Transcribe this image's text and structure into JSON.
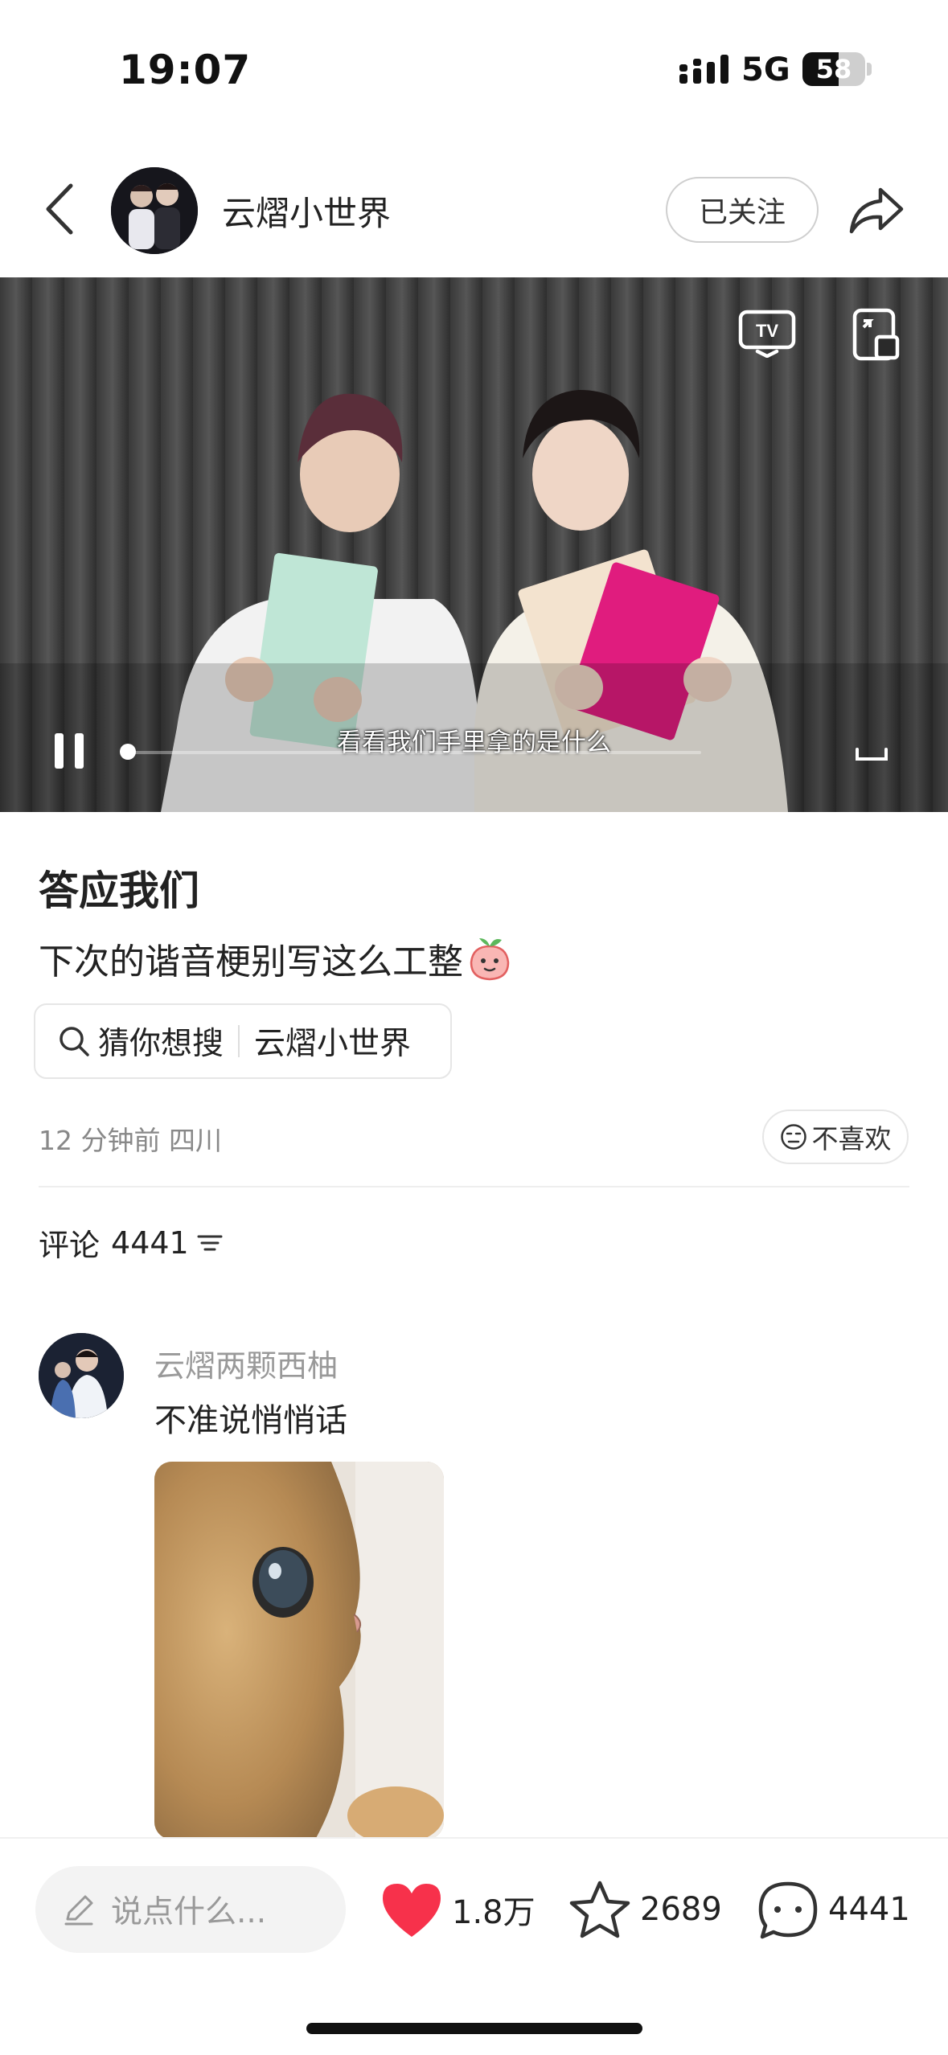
{
  "status_bar": {
    "time": "19:07",
    "network": "5G",
    "battery_level": "58",
    "battery_fraction": 0.58
  },
  "header": {
    "author_name": "云熠小世界",
    "follow_label": "已关注"
  },
  "video": {
    "subtitle": "看看我们手里拿的是什么",
    "playback_state": "playing",
    "progress_fraction": 0.01
  },
  "post": {
    "title": "答应我们",
    "text": "下次的谐音梗别写这么工整",
    "search": {
      "label": "猜你想搜",
      "term": "云熠小世界"
    },
    "meta": "12 分钟前  四川",
    "dislike_label": "不喜欢"
  },
  "comments": {
    "label": "评论",
    "count": "4441",
    "items": [
      {
        "author": "云熠两颗西柚",
        "text": "不准说悄悄话"
      }
    ]
  },
  "bottom_bar": {
    "input_placeholder": "说点什么...",
    "likes": "1.8万",
    "collects": "2689",
    "comments": "4441"
  },
  "colors": {
    "like_red": "#f7314b",
    "text_primary": "#222222",
    "text_secondary": "#888888"
  },
  "icons": [
    "back-icon",
    "share-icon",
    "tv-cast-icon",
    "pip-icon",
    "pause-icon",
    "fullscreen-icon",
    "peach-emoji-icon",
    "search-icon",
    "dislike-face-icon",
    "sort-icon",
    "pencil-icon",
    "heart-icon",
    "star-icon",
    "comment-bubble-icon"
  ]
}
